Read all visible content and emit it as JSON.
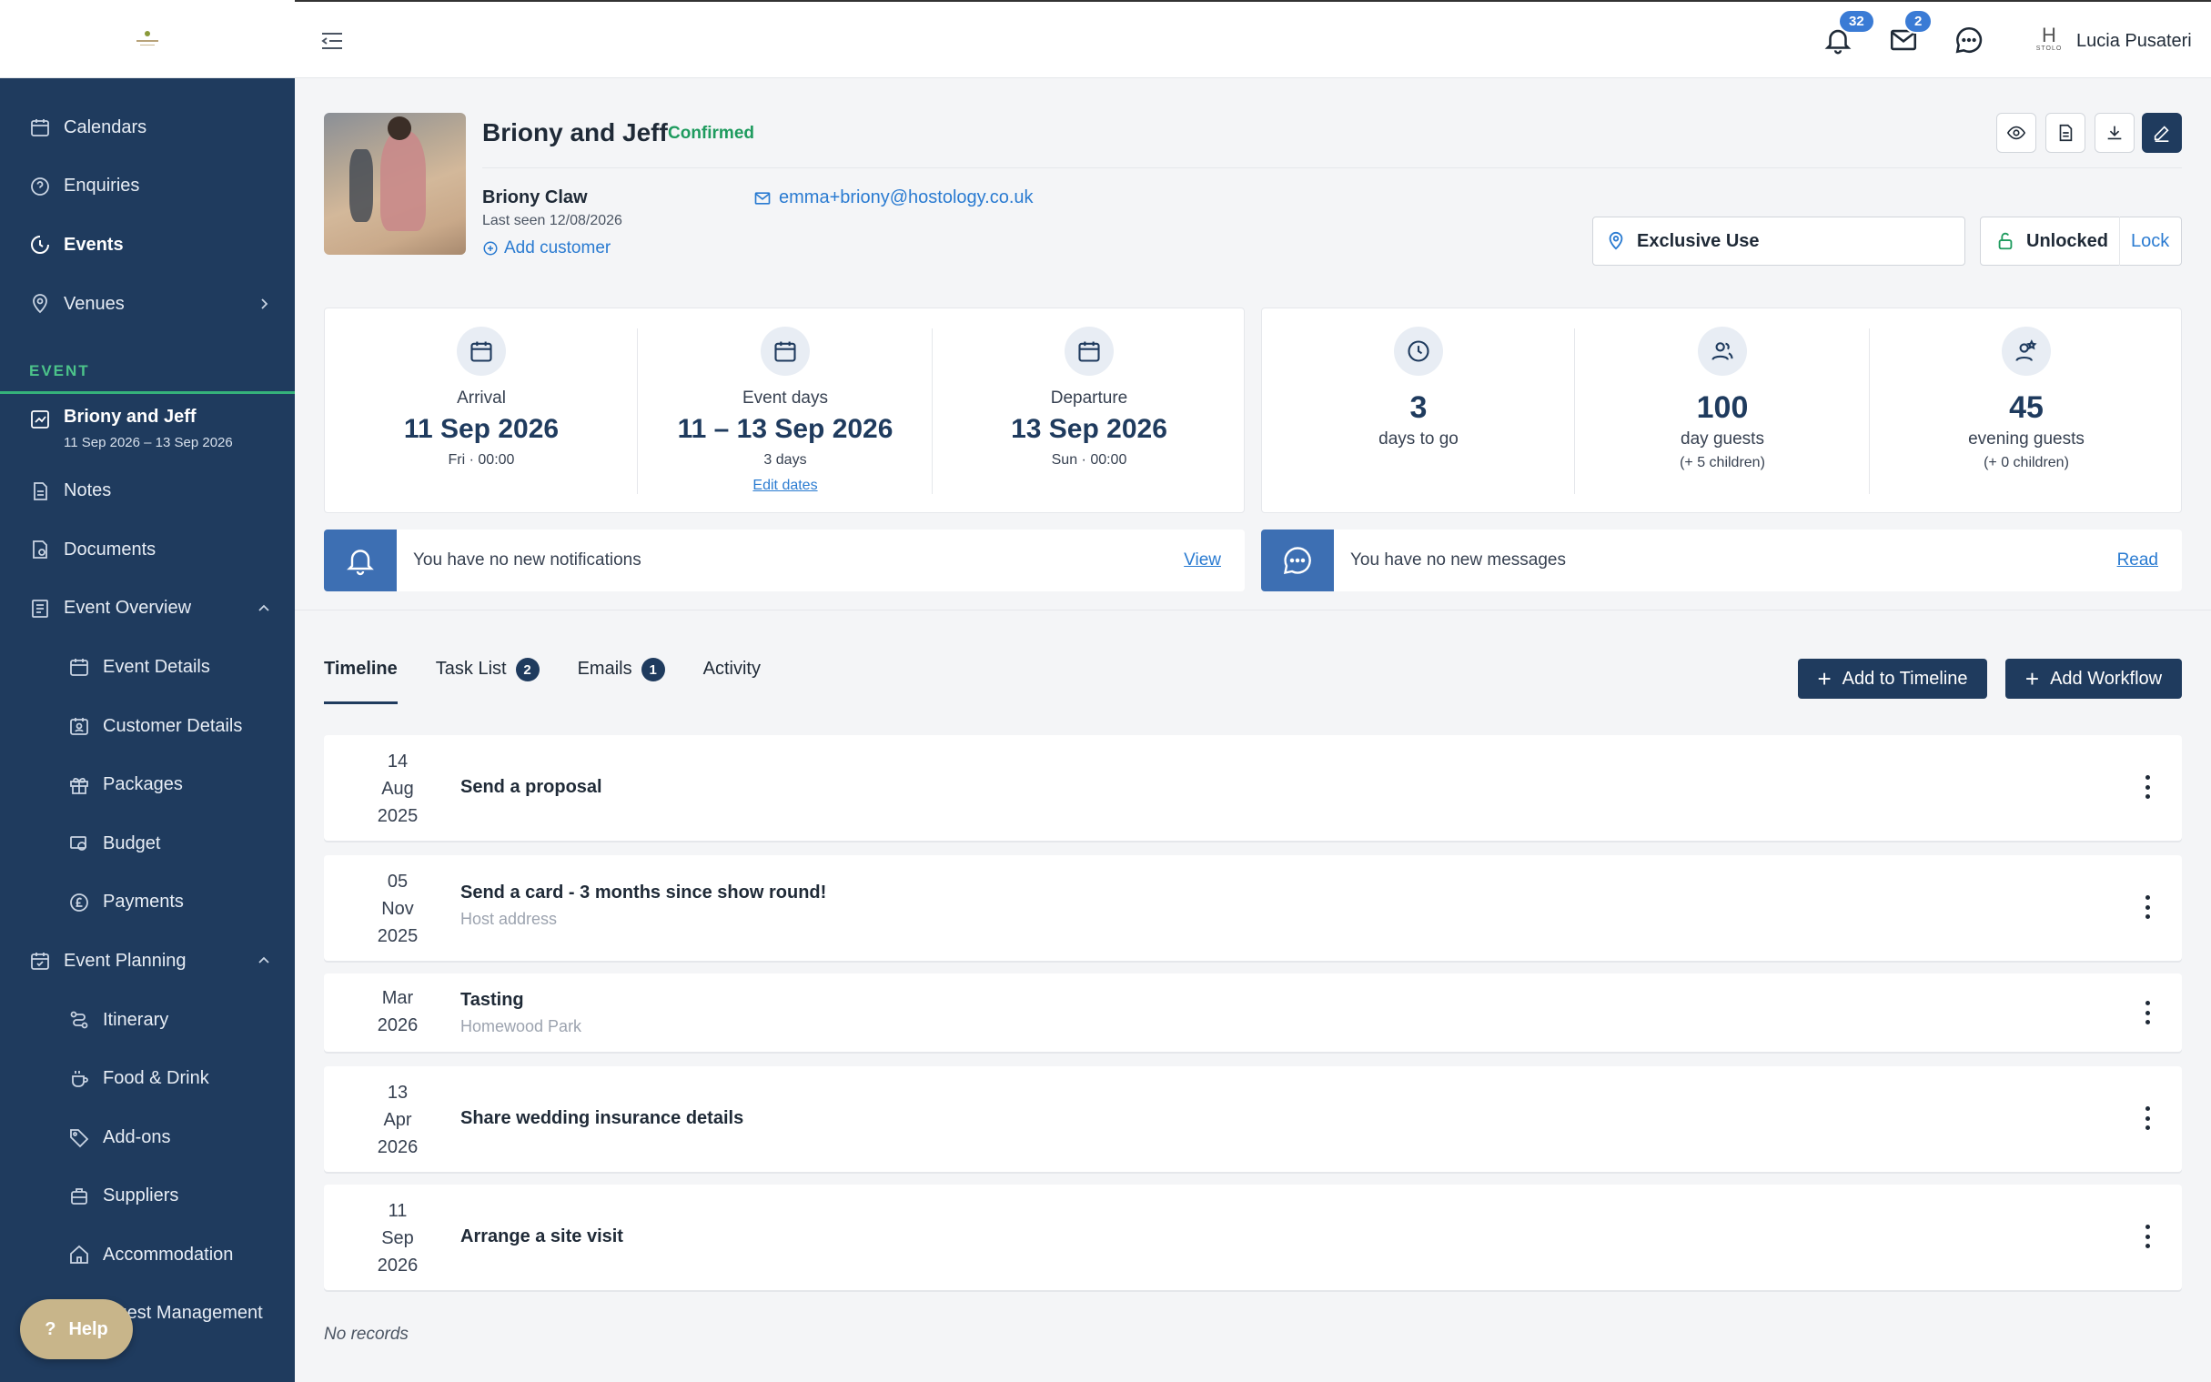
{
  "topbar": {
    "notifications_count": "32",
    "mail_count": "2",
    "user_name": "Lucia Pusateri",
    "logo_letter": "H",
    "logo_text": "STOLO"
  },
  "sidebar": {
    "items": [
      {
        "label": "Calendars"
      },
      {
        "label": "Enquiries"
      },
      {
        "label": "Events"
      },
      {
        "label": "Venues"
      }
    ],
    "section_label": "EVENT",
    "event": {
      "title": "Briony and Jeff",
      "dates": "11 Sep 2026 – 13 Sep 2026"
    },
    "event_items": [
      {
        "label": "Notes"
      },
      {
        "label": "Documents"
      },
      {
        "label": "Event Overview"
      },
      {
        "label": "Event Details"
      },
      {
        "label": "Customer Details"
      },
      {
        "label": "Packages"
      },
      {
        "label": "Budget"
      },
      {
        "label": "Payments"
      },
      {
        "label": "Event Planning"
      },
      {
        "label": "Itinerary"
      },
      {
        "label": "Food & Drink"
      },
      {
        "label": "Add-ons"
      },
      {
        "label": "Suppliers"
      },
      {
        "label": "Accommodation"
      },
      {
        "label": "Guest Management"
      }
    ],
    "help_label": "Help"
  },
  "header": {
    "title": "Briony and Jeff",
    "status": "Confirmed",
    "customer_name": "Briony Claw",
    "last_seen": "Last seen 12/08/2026",
    "add_customer": "Add customer",
    "email": "emma+briony@hostology.co.uk",
    "venue": "Exclusive Use",
    "lock_state": "Unlocked",
    "lock_action": "Lock"
  },
  "dates": {
    "arrival": {
      "label": "Arrival",
      "date": "11 Sep 2026",
      "sub": "Fri · 00:00"
    },
    "event_days": {
      "label": "Event days",
      "date": "11 – 13 Sep 2026",
      "sub": "3 days",
      "link": "Edit dates"
    },
    "departure": {
      "label": "Departure",
      "date": "13 Sep 2026",
      "sub": "Sun · 00:00"
    }
  },
  "counts": {
    "days": {
      "value": "3",
      "label": "days to go"
    },
    "day_guests": {
      "value": "100",
      "label": "day guests",
      "sub": "(+ 5 children)"
    },
    "evening_guests": {
      "value": "45",
      "label": "evening guests",
      "sub": "(+ 0 children)"
    }
  },
  "notices": {
    "notifications": {
      "text": "You have no new notifications",
      "link": "View"
    },
    "messages": {
      "text": "You have no new messages",
      "link": "Read"
    }
  },
  "tabs": [
    {
      "label": "Timeline"
    },
    {
      "label": "Task List",
      "count": "2"
    },
    {
      "label": "Emails",
      "count": "1"
    },
    {
      "label": "Activity"
    }
  ],
  "buttons": {
    "add_timeline": "Add to Timeline",
    "add_workflow": "Add Workflow"
  },
  "timeline": [
    {
      "day": "14",
      "month": "Aug",
      "year": "2025",
      "title": "Send a proposal",
      "sub": ""
    },
    {
      "day": "05",
      "month": "Nov",
      "year": "2025",
      "title": "Send a card - 3 months since show round!",
      "sub": "Host address"
    },
    {
      "day": "",
      "month": "Mar",
      "year": "2026",
      "title": "Tasting",
      "sub": "Homewood Park"
    },
    {
      "day": "13",
      "month": "Apr",
      "year": "2026",
      "title": "Share wedding insurance details",
      "sub": ""
    },
    {
      "day": "11",
      "month": "Sep",
      "year": "2026",
      "title": "Arrange a site visit",
      "sub": ""
    }
  ],
  "footer": {
    "no_records": "No records"
  },
  "colors": {
    "sidebar": "#1f3b5e",
    "accent": "#2a7bd1",
    "success": "#1e9b5e",
    "notice": "#3d6fb3"
  }
}
